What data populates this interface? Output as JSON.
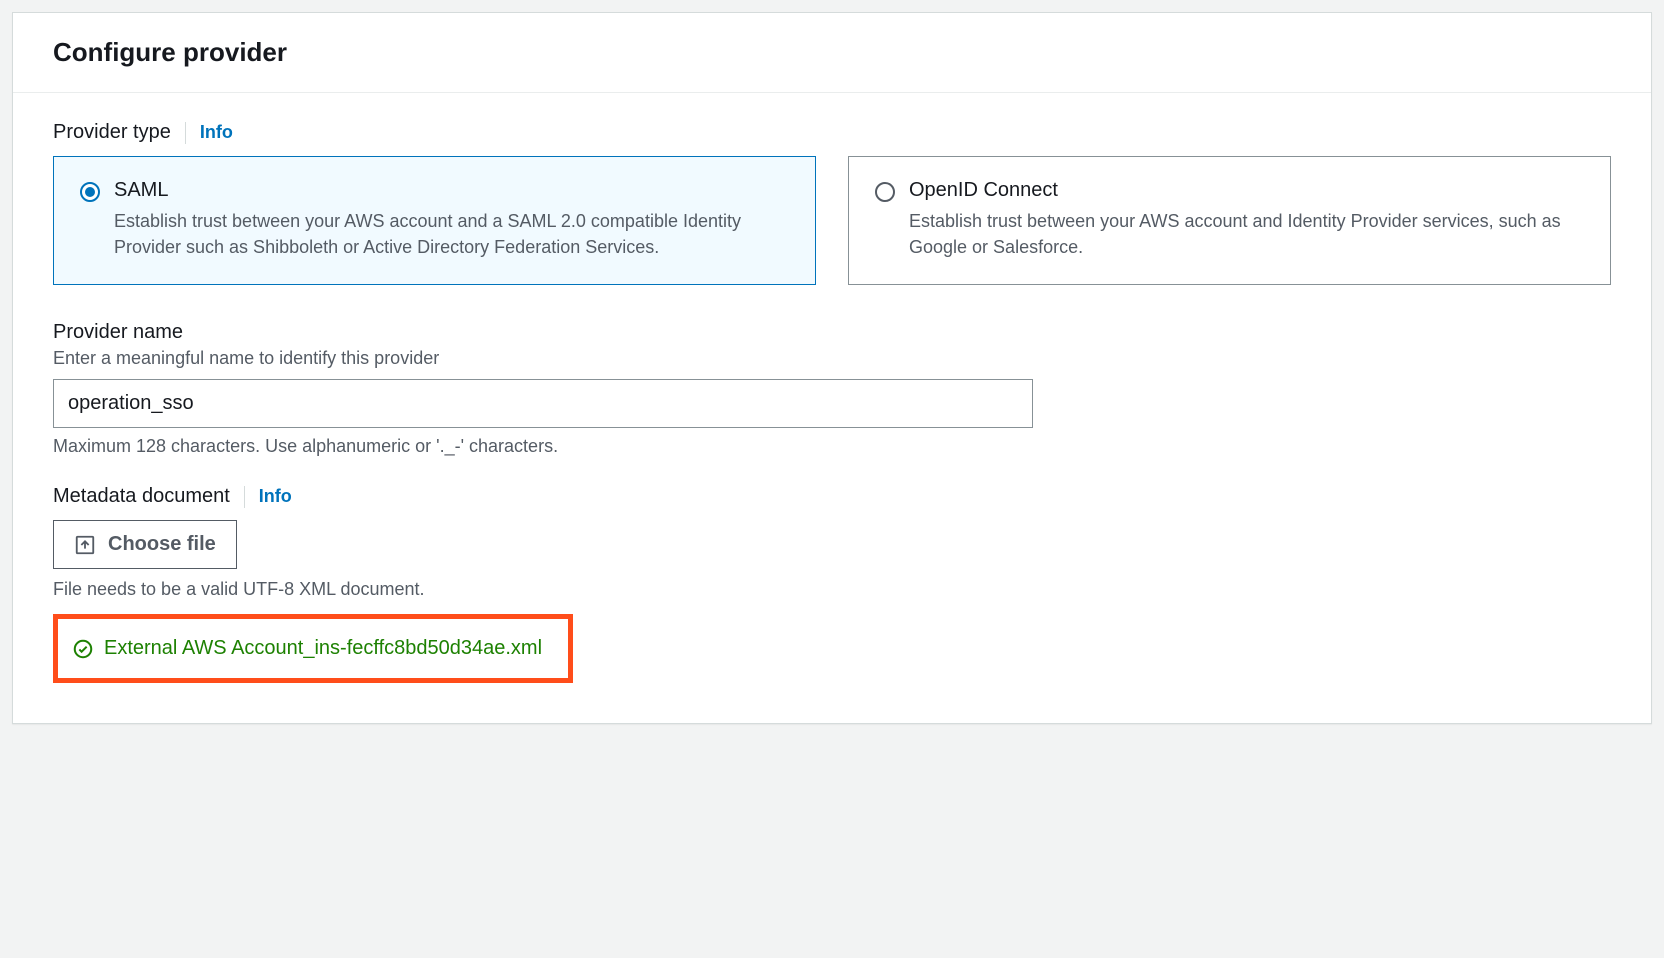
{
  "header": {
    "title": "Configure provider"
  },
  "providerType": {
    "label": "Provider type",
    "infoLabel": "Info",
    "options": {
      "saml": {
        "title": "SAML",
        "description": "Establish trust between your AWS account and a SAML 2.0 compatible Identity Provider such as Shibboleth or Active Directory Federation Services."
      },
      "openid": {
        "title": "OpenID Connect",
        "description": "Establish trust between your AWS account and Identity Provider services, such as Google or Salesforce."
      }
    }
  },
  "providerName": {
    "label": "Provider name",
    "hint": "Enter a meaningful name to identify this provider",
    "value": "operation_sso",
    "constraint": "Maximum 128 characters. Use alphanumeric or '._-' characters."
  },
  "metadataDocument": {
    "label": "Metadata document",
    "infoLabel": "Info",
    "chooseFileLabel": "Choose file",
    "fileNote": "File needs to be a valid UTF-8 XML document.",
    "uploadedFileName": "External AWS Account_ins-fecffc8bd50d34ae.xml"
  }
}
